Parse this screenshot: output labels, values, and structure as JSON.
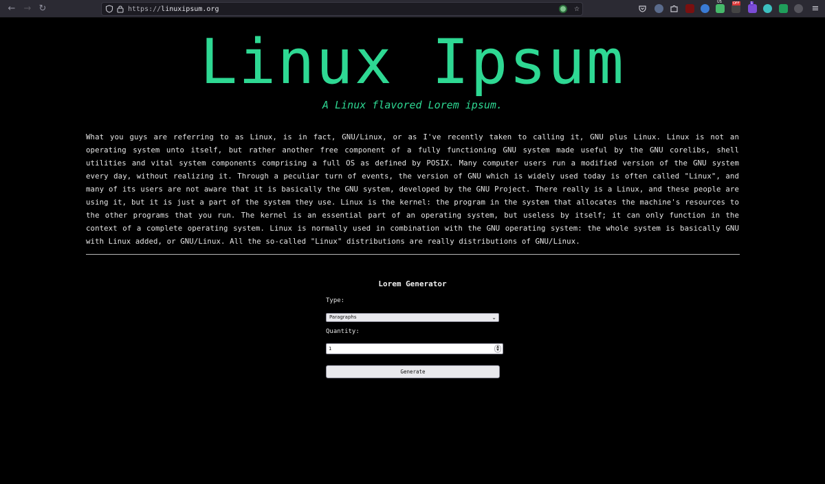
{
  "browser": {
    "url_scheme": "https://",
    "url_host": "linuxipsum.org",
    "back_icon": "arrow-left-icon",
    "forward_icon": "arrow-right-icon",
    "reload_icon": "reload-icon",
    "bookmark_icon": "star-icon",
    "menu_icon": "hamburger-icon",
    "extension_badges": {
      "badge_us": "US",
      "badge_off": "OFF",
      "badge_count": "1"
    }
  },
  "hero": {
    "title": "Linux Ipsum",
    "subtitle": "A Linux flavored Lorem ipsum."
  },
  "lipsum": {
    "text": "What you guys are referring to as Linux, is in fact, GNU/Linux, or as I've recently taken to calling it, GNU plus Linux. Linux is not an operating system unto itself, but rather another free component of a fully functioning GNU system made useful by the GNU corelibs, shell utilities and vital system components comprising a full OS as defined by POSIX. Many computer users run a modified version of the GNU system every day, without realizing it. Through a peculiar turn of events, the version of GNU which is widely used today is often called \"Linux\", and many of its users are not aware that it is basically the GNU system, developed by the GNU Project. There really is a Linux, and these people are using it, but it is just a part of the system they use. Linux is the kernel: the program in the system that allocates the machine's resources to the other programs that you run. The kernel is an essential part of an operating system, but useless by itself; it can only function in the context of a complete operating system. Linux is normally used in combination with the GNU operating system: the whole system is basically GNU with Linux added, or GNU/Linux. All the so-called \"Linux\" distributions are really distributions of GNU/Linux."
  },
  "generator": {
    "title": "Lorem Generator",
    "type_label": "Type:",
    "type_value": "Paragraphs",
    "quantity_label": "Quantity:",
    "quantity_value": "1",
    "generate_label": "Generate"
  },
  "colors": {
    "accent": "#2ed893",
    "background": "#000000",
    "chrome": "#2b2a33"
  }
}
